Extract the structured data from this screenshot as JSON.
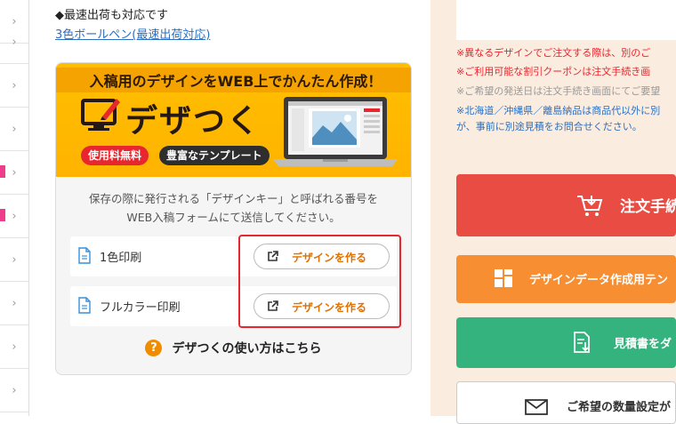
{
  "sidebar": {
    "rows": 10,
    "chevron": "›"
  },
  "main": {
    "note": "◆最速出荷も対応です",
    "link": "3色ボールペン(最速出荷対応)",
    "banner": {
      "headline": "入稿用のデザインをWEB上でかんたん作成！",
      "logo": "デザつく",
      "tag_free": "使用料無料",
      "tag_templates": "豊富なテンプレート"
    },
    "info_line1": "保存の際に発行される「デザインキー」と呼ばれる番号を",
    "info_line2": "WEB入稿フォームにて送信してください。",
    "options": [
      {
        "label": "1色印刷",
        "button": "デザインを作る"
      },
      {
        "label": "フルカラー印刷",
        "button": "デザインを作る"
      }
    ],
    "howto": "デザつくの使い方はこちら",
    "howto_icon": "?"
  },
  "right": {
    "notices": [
      {
        "text": "※異なるデザインでご注文する際は、別のご",
        "color": "red"
      },
      {
        "text": "※ご利用可能な割引クーポンは注文手続き画",
        "color": "red"
      },
      {
        "text": "※ご希望の発送日は注文手続き画面にてご要望",
        "color": "gray"
      },
      {
        "text": "※北海道／沖縄県／離島納品は商品代以外に別",
        "color": "blue"
      },
      {
        "text": "が、事前に別途見積をお問合せください。",
        "color": "blue"
      }
    ],
    "order_button": "注文手続",
    "template_button": "デザインデータ作成用テン",
    "quote_button": "見積書をダ",
    "mail_button": "ご希望の数量設定が"
  },
  "colors": {
    "accent_orange": "#e07000",
    "highlight_red": "#e8262e",
    "order_red": "#e94c43",
    "template_orange": "#f78e31",
    "quote_green": "#35b37e"
  }
}
